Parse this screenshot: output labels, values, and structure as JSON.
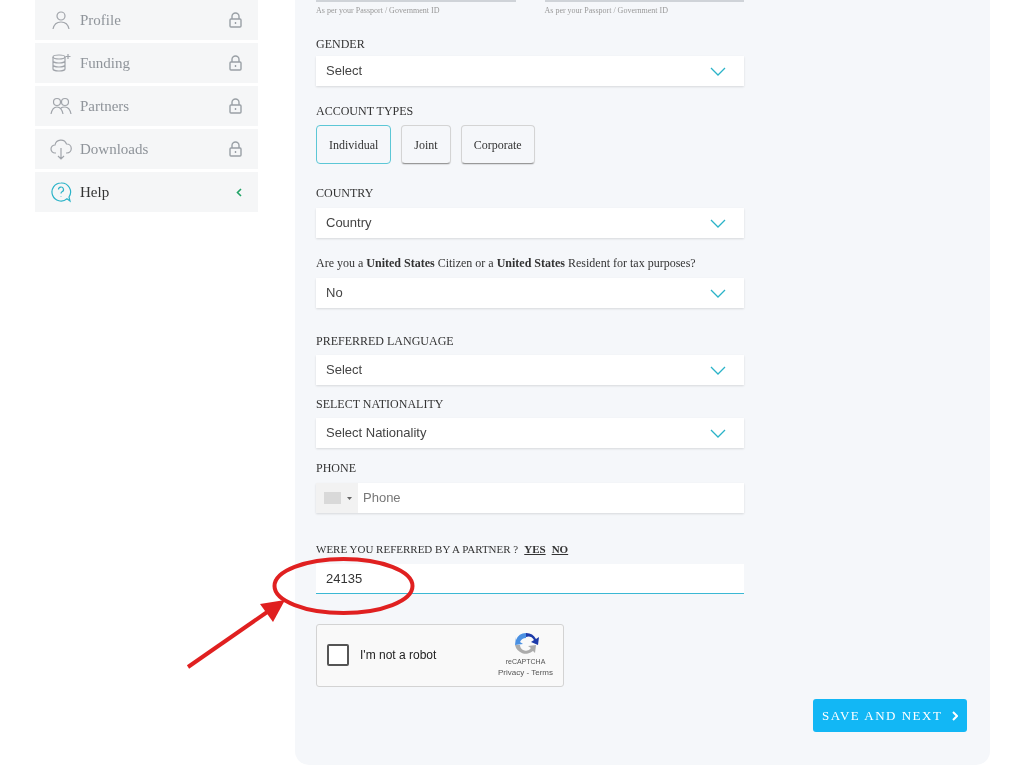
{
  "sidebar": {
    "items": [
      {
        "label": "Profile",
        "locked": true,
        "selected": false
      },
      {
        "label": "Funding",
        "locked": true,
        "selected": false
      },
      {
        "label": "Partners",
        "locked": true,
        "selected": false
      },
      {
        "label": "Downloads",
        "locked": true,
        "selected": false
      },
      {
        "label": "Help",
        "locked": false,
        "selected": true
      }
    ]
  },
  "form": {
    "name_hints": [
      "As per your Passport / Government ID",
      "As per your Passport / Government ID"
    ],
    "gender": {
      "label": "GENDER",
      "value": "Select"
    },
    "account_types": {
      "label": "ACCOUNT TYPES",
      "options": [
        {
          "label": "Individual",
          "selected": true
        },
        {
          "label": "Joint",
          "selected": false
        },
        {
          "label": "Corporate",
          "selected": false
        }
      ]
    },
    "country": {
      "label": "COUNTRY",
      "value": "Country"
    },
    "us_tax": {
      "question": "Are you a **United States** Citizen or a **United States** Resident for tax purposes?",
      "value": "No"
    },
    "language": {
      "label": "PREFERRED LANGUAGE",
      "value": "Select"
    },
    "nationality": {
      "label": "SELECT NATIONALITY",
      "value": "Select Nationality"
    },
    "phone": {
      "label": "PHONE",
      "placeholder": "Phone"
    },
    "referral": {
      "question": "WERE YOU REFERRED BY A PARTNER ?",
      "options": [
        "YES",
        "NO"
      ],
      "value": "24135"
    },
    "captcha": {
      "label": "I'm not a robot",
      "brand": "reCAPTCHA",
      "links": "Privacy - Terms",
      "checked": false
    },
    "submit": "SAVE AND NEXT"
  }
}
